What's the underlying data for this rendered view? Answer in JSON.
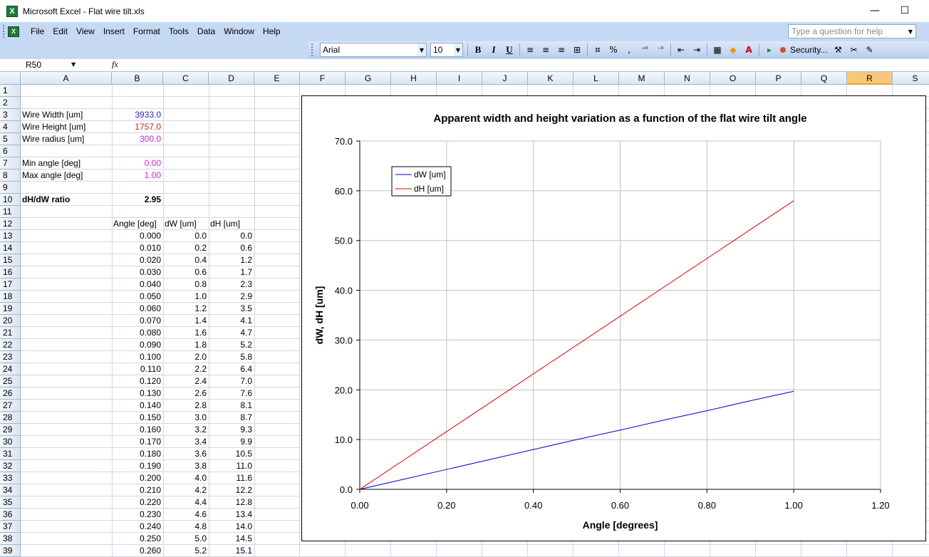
{
  "window": {
    "title": "Microsoft Excel - Flat wire tilt.xls",
    "minimize_glyph": "—",
    "maximize_glyph": "☐"
  },
  "menu": {
    "items": [
      "File",
      "Edit",
      "View",
      "Insert",
      "Format",
      "Tools",
      "Data",
      "Window",
      "Help"
    ],
    "help_placeholder": "Type a question for help"
  },
  "toolbar": {
    "font": "Arial",
    "size": "10",
    "bold": "B",
    "italic": "I",
    "underline": "U",
    "percent": "%",
    "comma": ",",
    "security": "Security..."
  },
  "formula_bar": {
    "name_box": "R50",
    "fx": "fx"
  },
  "grid": {
    "columns": [
      "A",
      "B",
      "C",
      "D",
      "E",
      "F",
      "G",
      "H",
      "I",
      "J",
      "K",
      "L",
      "M",
      "N",
      "O",
      "P",
      "Q",
      "R",
      "S"
    ],
    "selected_column": "R",
    "rows": [
      "1",
      "2",
      "3",
      "4",
      "5",
      "6",
      "7",
      "8",
      "9",
      "10",
      "11",
      "12",
      "13",
      "14",
      "15",
      "16",
      "17",
      "18",
      "19",
      "20",
      "21",
      "22",
      "23",
      "24",
      "25",
      "26",
      "27",
      "28",
      "29",
      "30",
      "31",
      "32",
      "33",
      "34",
      "35",
      "36",
      "37",
      "38",
      "39"
    ],
    "params": [
      {
        "row": 3,
        "label": "Wire Width [um]",
        "value": "3933.0",
        "color": "#1f1fd0"
      },
      {
        "row": 4,
        "label": "Wire Height [um]",
        "value": "1757.0",
        "color": "#d01f1f"
      },
      {
        "row": 5,
        "label": "Wire radius [um]",
        "value": "300.0",
        "color": "#d01fd0"
      },
      {
        "row": 7,
        "label": "Min angle [deg]",
        "value": "0.00",
        "color": "#d01fd0"
      },
      {
        "row": 8,
        "label": "Max angle [deg]",
        "value": "1.00",
        "color": "#d01fd0"
      }
    ],
    "ratio": {
      "row": 10,
      "label": "dH/dW ratio",
      "value": "2.95"
    },
    "table_header": {
      "row": 12,
      "angle": "Angle [deg]",
      "dw": "dW [um]",
      "dh": "dH [um]"
    },
    "table_rows": [
      [
        "0.000",
        "0.0",
        "0.0"
      ],
      [
        "0.010",
        "0.2",
        "0.6"
      ],
      [
        "0.020",
        "0.4",
        "1.2"
      ],
      [
        "0.030",
        "0.6",
        "1.7"
      ],
      [
        "0.040",
        "0.8",
        "2.3"
      ],
      [
        "0.050",
        "1.0",
        "2.9"
      ],
      [
        "0.060",
        "1.2",
        "3.5"
      ],
      [
        "0.070",
        "1.4",
        "4.1"
      ],
      [
        "0.080",
        "1.6",
        "4.7"
      ],
      [
        "0.090",
        "1.8",
        "5.2"
      ],
      [
        "0.100",
        "2.0",
        "5.8"
      ],
      [
        "0.110",
        "2.2",
        "6.4"
      ],
      [
        "0.120",
        "2.4",
        "7.0"
      ],
      [
        "0.130",
        "2.6",
        "7.6"
      ],
      [
        "0.140",
        "2.8",
        "8.1"
      ],
      [
        "0.150",
        "3.0",
        "8.7"
      ],
      [
        "0.160",
        "3.2",
        "9.3"
      ],
      [
        "0.170",
        "3.4",
        "9.9"
      ],
      [
        "0.180",
        "3.6",
        "10.5"
      ],
      [
        "0.190",
        "3.8",
        "11.0"
      ],
      [
        "0.200",
        "4.0",
        "11.6"
      ],
      [
        "0.210",
        "4.2",
        "12.2"
      ],
      [
        "0.220",
        "4.4",
        "12.8"
      ],
      [
        "0.230",
        "4.6",
        "13.4"
      ],
      [
        "0.240",
        "4.8",
        "14.0"
      ],
      [
        "0.250",
        "5.0",
        "14.5"
      ],
      [
        "0.260",
        "5.2",
        "15.1"
      ]
    ]
  },
  "chart_data": {
    "type": "line",
    "title": "Apparent width and height variation as a function of the flat wire tilt angle",
    "xlabel": "Angle [degrees]",
    "ylabel": "dW, dH [um]",
    "xlim": [
      0,
      1.2
    ],
    "ylim": [
      0,
      70
    ],
    "xticks": [
      "0.00",
      "0.20",
      "0.40",
      "0.60",
      "0.80",
      "1.00",
      "1.20"
    ],
    "yticks": [
      "0.0",
      "10.0",
      "20.0",
      "30.0",
      "40.0",
      "50.0",
      "60.0",
      "70.0"
    ],
    "grid": true,
    "legend_placement": "top-left",
    "x": [
      0,
      0.1,
      0.2,
      0.3,
      0.4,
      0.5,
      0.6,
      0.7,
      0.8,
      0.9,
      1.0
    ],
    "series": [
      {
        "name": "dW [um]",
        "color": "#0000c8",
        "values": [
          0,
          2.0,
          4.0,
          6.0,
          8.0,
          10.0,
          11.9,
          13.9,
          15.8,
          17.8,
          19.7
        ]
      },
      {
        "name": "dH [um]",
        "color": "#e00000",
        "values": [
          0,
          5.8,
          11.6,
          17.4,
          23.2,
          29.0,
          34.8,
          40.6,
          46.4,
          52.2,
          58.0
        ]
      }
    ]
  }
}
